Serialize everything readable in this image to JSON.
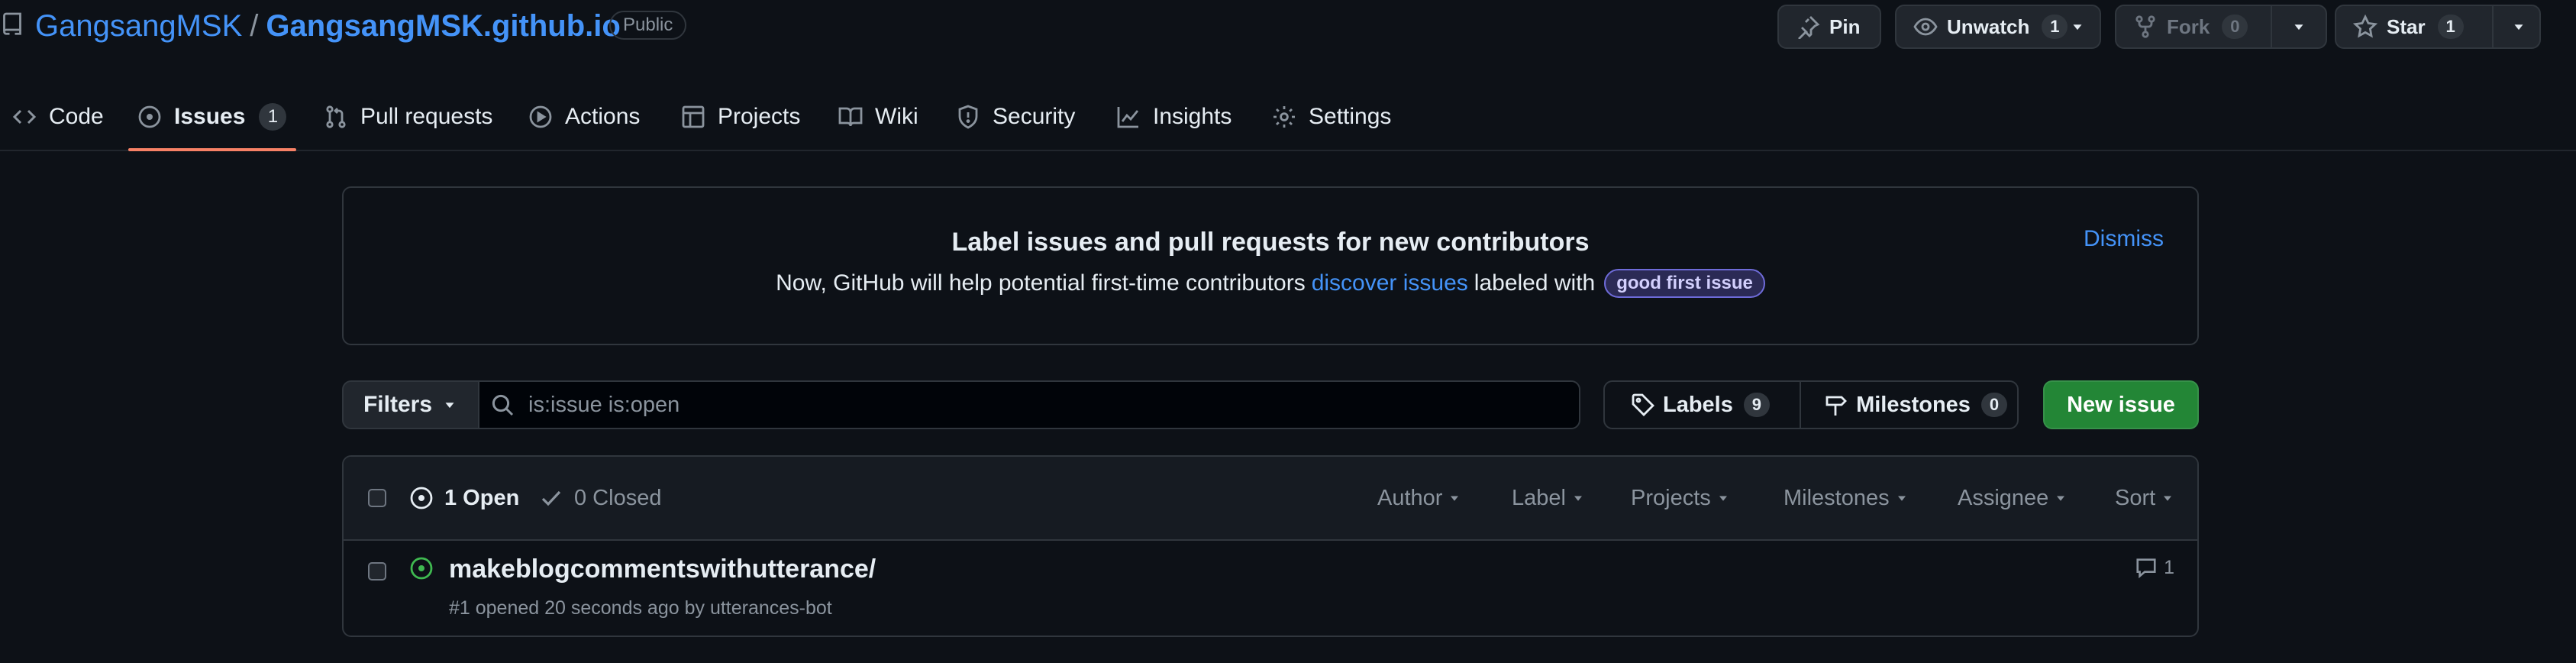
{
  "repo": {
    "owner": "GangsangMSK",
    "separator": "/",
    "name": "GangsangMSK.github.io",
    "visibility": "Public"
  },
  "actions": {
    "pin": {
      "label": "Pin"
    },
    "watch": {
      "label": "Unwatch",
      "count": "1"
    },
    "fork": {
      "label": "Fork",
      "count": "0"
    },
    "star": {
      "label": "Star",
      "count": "1"
    }
  },
  "tabs": [
    {
      "label": "Code",
      "icon": "code-icon"
    },
    {
      "label": "Issues",
      "icon": "issue-opened-icon",
      "count": "1",
      "active": true
    },
    {
      "label": "Pull requests",
      "icon": "git-pull-request-icon"
    },
    {
      "label": "Actions",
      "icon": "play-icon"
    },
    {
      "label": "Projects",
      "icon": "table-icon"
    },
    {
      "label": "Wiki",
      "icon": "book-icon"
    },
    {
      "label": "Security",
      "icon": "shield-icon"
    },
    {
      "label": "Insights",
      "icon": "graph-icon"
    },
    {
      "label": "Settings",
      "icon": "gear-icon"
    }
  ],
  "banner": {
    "title": "Label issues and pull requests for new contributors",
    "desc_before": "Now, GitHub will help potential first-time contributors",
    "desc_link": "discover issues",
    "desc_after": "labeled with",
    "label": "good first issue",
    "dismiss": "Dismiss"
  },
  "toolbar": {
    "filters": "Filters",
    "search_value": "is:issue is:open",
    "labels": "Labels",
    "labels_count": "9",
    "milestones": "Milestones",
    "milestones_count": "0",
    "new_issue": "New issue"
  },
  "list_header": {
    "open": "1 Open",
    "closed": "0 Closed",
    "filters": [
      "Author",
      "Label",
      "Projects",
      "Milestones",
      "Assignee",
      "Sort"
    ]
  },
  "issues": [
    {
      "title": "makeblogcommentswithutterance/",
      "meta": "#1 opened 20 seconds ago by utterances-bot",
      "comments": "1"
    }
  ],
  "colors": {
    "accent_link": "#4493f8",
    "open_green": "#3fb950",
    "button_green": "#238636",
    "tab_underline": "#f78166"
  }
}
